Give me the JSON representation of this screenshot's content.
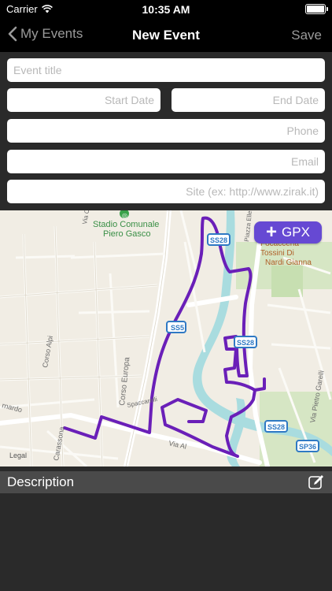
{
  "status_bar": {
    "carrier": "Carrier",
    "time": "10:35 AM"
  },
  "nav": {
    "back_label": "My Events",
    "title": "New Event",
    "save_label": "Save"
  },
  "form": {
    "event_title_placeholder": "Event title",
    "start_date_placeholder": "Start Date",
    "end_date_placeholder": "End Date",
    "phone_placeholder": "Phone",
    "email_placeholder": "Email",
    "site_placeholder": "Site (ex: http://www.zirak.it)"
  },
  "map": {
    "gpx_label": "GPX",
    "labels": {
      "stadium_line1": "Stadio Comunale",
      "stadium_line2": "Piero Gasco",
      "corso_europa": "Corso Europa",
      "corso_alpi": "Corso Alpi",
      "carassona": "Carassona",
      "focacceria_1": "Focacceria",
      "focacceria_2": "Tossini Di",
      "focacceria_3": "Nardi Gianna",
      "via_pietro_garelli": "Via Pietro Garelli",
      "via_al": "Via Al",
      "legal": "Legal",
      "via_ca": "Via Ca",
      "piazza_ellero": "Piazza Ellero",
      "rnardo": "rnardo",
      "spaccarelli": "Spaccarelli"
    },
    "shields": {
      "ss28_top": "SS28",
      "ss5": "SS5",
      "ss28_mid": "SS28",
      "ss28_bottom": "SS28",
      "sp36": "SP36"
    }
  },
  "description": {
    "label": "Description"
  },
  "colors": {
    "route": "#6a1fb8",
    "gpx_button": "#6649d3",
    "river": "#a9dcdf",
    "map_bg": "#f1ede4"
  }
}
